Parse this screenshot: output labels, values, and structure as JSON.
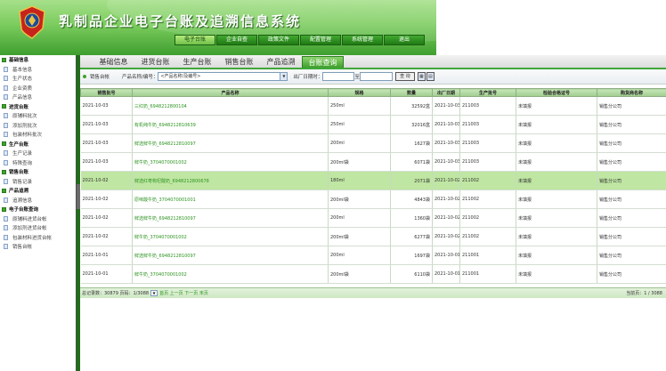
{
  "app": {
    "title": "乳制品企业电子台账及追溯信息系统"
  },
  "topnav": [
    "电子台账",
    "企业自查",
    "政策文件",
    "配置管理",
    "系统管理",
    "退出"
  ],
  "sidebar": [
    {
      "type": "group",
      "label": "基础信息"
    },
    {
      "type": "item",
      "label": "基本信息"
    },
    {
      "type": "item",
      "label": "生产状态"
    },
    {
      "type": "item",
      "label": "企业资质"
    },
    {
      "type": "item",
      "label": "产品信息"
    },
    {
      "type": "group",
      "label": "进货台账"
    },
    {
      "type": "item",
      "label": "原辅料批次"
    },
    {
      "type": "item",
      "label": "添加剂批次"
    },
    {
      "type": "item",
      "label": "包装材料批次"
    },
    {
      "type": "group",
      "label": "生产台账"
    },
    {
      "type": "item",
      "label": "生产记录"
    },
    {
      "type": "item",
      "label": "特殊查询"
    },
    {
      "type": "group",
      "label": "销售台账"
    },
    {
      "type": "item",
      "label": "销售记录"
    },
    {
      "type": "group",
      "label": "产品追溯"
    },
    {
      "type": "item",
      "label": "追溯信息"
    },
    {
      "type": "group",
      "label": "电子台账查询"
    },
    {
      "type": "item",
      "label": "原辅料进货台帐"
    },
    {
      "type": "item",
      "label": "添加剂进货台帐"
    },
    {
      "type": "item",
      "label": "包装材料进货台帐"
    },
    {
      "type": "item",
      "label": "销售台帐"
    }
  ],
  "tabs": [
    {
      "label": "基础信息",
      "active": false
    },
    {
      "label": "进货台账",
      "active": false
    },
    {
      "label": "生产台账",
      "active": false
    },
    {
      "label": "销售台账",
      "active": false
    },
    {
      "label": "产品追溯",
      "active": false
    },
    {
      "label": "台账查询",
      "active": true
    }
  ],
  "filter": {
    "crumb": "销售台帐",
    "product_label": "产品名称/编号：",
    "product_value": "<产品名称/及编号>",
    "date_label": "出厂日期时：",
    "date_sep": "至",
    "query_button": "查 询"
  },
  "table": {
    "headers": [
      "销售批号",
      "产品名称",
      "规格",
      "数量",
      "出厂日期",
      "生产批号",
      "检验合格证号",
      "购货商名称"
    ],
    "rows": [
      [
        "2021-10-03",
        "三红奶_6948212800104",
        "250ml",
        "32592盒",
        "2021-10-03",
        "211003",
        "未填报",
        "销售分公司"
      ],
      [
        "2021-10-03",
        "有机纯牛奶_6948212810639",
        "250ml",
        "32016盒",
        "2021-10-03",
        "211003",
        "未填报",
        "销售分公司"
      ],
      [
        "2021-10-03",
        "鲜选鲜牛奶_6948212810097",
        "200ml",
        "1627袋",
        "2021-10-03",
        "211003",
        "未填报",
        "销售分公司"
      ],
      [
        "2021-10-03",
        "鲜牛奶_3704070001002",
        "200ml袋",
        "6071袋",
        "2021-10-03",
        "211003",
        "未填报",
        "销售分公司"
      ],
      [
        "2021-10-02",
        "鲜选红枣枸杞酸奶_6948212800678",
        "180ml",
        "2071袋",
        "2021-10-02",
        "211002",
        "未填报",
        "销售分公司"
      ],
      [
        "2021-10-02",
        "原味酸牛奶_3704070001001",
        "200ml袋",
        "4843袋",
        "2021-10-02",
        "211002",
        "未填报",
        "销售分公司"
      ],
      [
        "2021-10-02",
        "鲜选鲜牛奶_6948212810097",
        "200ml",
        "1360袋",
        "2021-10-02",
        "211002",
        "未填报",
        "销售分公司"
      ],
      [
        "2021-10-02",
        "鲜牛奶_3704070001002",
        "200ml袋",
        "6277袋",
        "2021-10-02",
        "211002",
        "未填报",
        "销售分公司"
      ],
      [
        "2021-10-01",
        "鲜选鲜牛奶_6948212810097",
        "200ml",
        "1697袋",
        "2021-10-01",
        "211001",
        "未填报",
        "销售分公司"
      ],
      [
        "2021-10-01",
        "鲜牛奶_3704070001002",
        "200ml袋",
        "6110袋",
        "2021-10-01",
        "211001",
        "未填报",
        "销售分公司"
      ]
    ],
    "highlight_row": 4
  },
  "pager": {
    "total": "总记录数：30879 页码：1/3088",
    "links": "首页 上一页 下一页 末页",
    "current": "当前页：1 / 3088"
  }
}
